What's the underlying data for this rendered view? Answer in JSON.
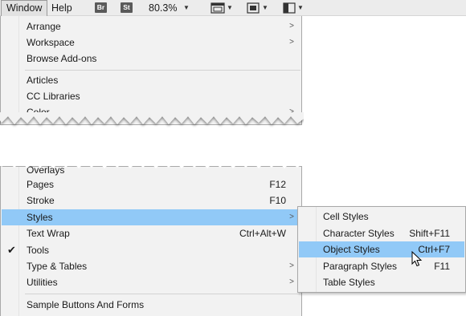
{
  "menubar": {
    "window_label": "Window",
    "help_label": "Help",
    "br_badge": "Br",
    "st_badge": "St",
    "zoom_value": "80.3%",
    "icons": [
      "view-options-icon",
      "screen-mode-icon",
      "arrange-documents-icon"
    ]
  },
  "window_menu_top": {
    "items": [
      {
        "label": "Arrange",
        "submenu": true
      },
      {
        "label": "Workspace",
        "submenu": true
      },
      {
        "label": "Browse Add-ons",
        "submenu": false
      },
      {
        "label": "Articles",
        "submenu": false
      },
      {
        "label": "CC Libraries",
        "submenu": false
      },
      {
        "label": "Color",
        "submenu": true
      }
    ]
  },
  "window_menu_bottom": {
    "items": [
      {
        "label": "Overlays",
        "shortcut": ""
      },
      {
        "label": "Pages",
        "shortcut": "F12"
      },
      {
        "label": "Stroke",
        "shortcut": "F10"
      },
      {
        "label": "Styles",
        "shortcut": "",
        "submenu": true,
        "selected": true
      },
      {
        "label": "Text Wrap",
        "shortcut": "Ctrl+Alt+W"
      },
      {
        "label": "Tools",
        "shortcut": "",
        "checked": true
      },
      {
        "label": "Type & Tables",
        "shortcut": "",
        "submenu": true
      },
      {
        "label": "Utilities",
        "shortcut": "",
        "submenu": true
      },
      {
        "label": "Sample Buttons And Forms",
        "shortcut": ""
      }
    ]
  },
  "styles_submenu": {
    "items": [
      {
        "label": "Cell Styles",
        "shortcut": ""
      },
      {
        "label": "Character Styles",
        "shortcut": "Shift+F11"
      },
      {
        "label": "Object Styles",
        "shortcut": "Ctrl+F7",
        "selected": true
      },
      {
        "label": "Paragraph Styles",
        "shortcut": "F11"
      },
      {
        "label": "Table Styles",
        "shortcut": ""
      }
    ]
  },
  "colors": {
    "menu_bg": "#f2f2f2",
    "highlight": "#91c9f7",
    "menubar_bg": "#ececec"
  }
}
